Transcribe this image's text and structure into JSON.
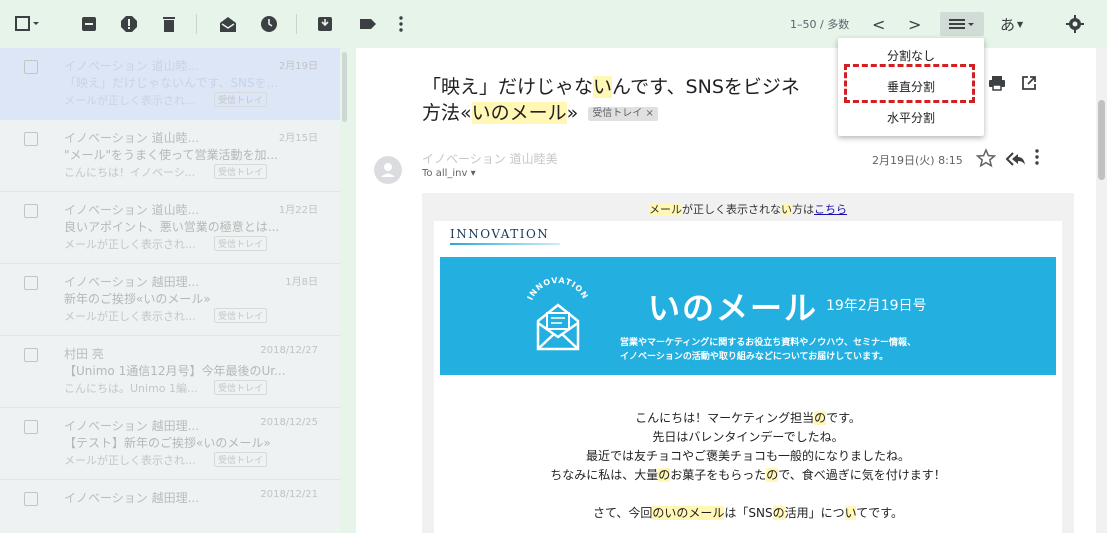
{
  "toolbar": {
    "pager": "1–50 / 多数",
    "prev": "<",
    "next": ">",
    "input_tool": "あ"
  },
  "mail_list": [
    {
      "from": "イノベーション 道山睦...",
      "date": "2月19日",
      "subject": "「映え」だけじゃないんです、SNSを...",
      "snippet": "メールが正しく表示され...",
      "label": "受信トレイ",
      "selected": true
    },
    {
      "from": "イノベーション 道山睦...",
      "date": "2月15日",
      "subject": "\"メール\"をうまく使って営業活動を加...",
      "snippet": "こんにちは！イノベーシ...",
      "label": "受信トレイ",
      "selected": false
    },
    {
      "from": "イノベーション 道山睦...",
      "date": "1月22日",
      "subject": "良いアポイント、悪い営業の極意とは...",
      "snippet": "メールが正しく表示され...",
      "label": "受信トレイ",
      "selected": false
    },
    {
      "from": "イノベーション 越田理...",
      "date": "1月8日",
      "subject": "新年のご挨拶«いのメール»",
      "snippet": "メールが正しく表示され...",
      "label": "受信トレイ",
      "selected": false
    },
    {
      "from": "村田 亮",
      "date": "2018/12/27",
      "subject": "【Unimo 1通信12月号】今年最後のUr...",
      "snippet": "こんにちは。Unimo 1編...",
      "label": "受信トレイ",
      "selected": false
    },
    {
      "from": "イノベーション 越田理...",
      "date": "2018/12/25",
      "subject": "【テスト】新年のご挨拶«いのメール»",
      "snippet": "メールが正しく表示され...",
      "label": "受信トレイ",
      "selected": false
    },
    {
      "from": "イノベーション 越田理...",
      "date": "2018/12/21",
      "subject": "",
      "snippet": "",
      "label": "",
      "selected": false
    }
  ],
  "message": {
    "subject_line1_pre": "「映え」だけじゃな",
    "subject_line1_hl": "い",
    "subject_line1_post": "んです、SNSをビジネ",
    "subject_line2_pre": "方法«",
    "subject_line2_hl": "いのメール",
    "subject_line2_post": "»",
    "inbox_chip": "受信トレイ ×",
    "sender": "イノベーション 道山睦美",
    "to": "To all_inv ▾",
    "date": "2月19日(火) 8:15"
  },
  "email_body": {
    "notice_hl1": "メール",
    "notice_mid": "が正しく表示されな",
    "notice_hl2": "い",
    "notice_post": "方は",
    "notice_link": "こちら",
    "brand": "INNOVATION",
    "banner_logo_text": "INNOVATION",
    "banner_title": "いのメール",
    "banner_date": "19年2月19日号",
    "banner_desc1": "営業やマーケティングに関するお役立ち資料やノウハウ、セミナー情報、",
    "banner_desc2": "イノベーションの活動や取り組みなどについてお届けしています。",
    "line1_pre": "こんにちは！マーケティング担当",
    "line1_hl": "の",
    "line1_post": "です。",
    "line2": "先日はバレンタインデーでしたね。",
    "line3": "最近では友チョコやご褒美チョコも一般的になりましたね。",
    "line4_a": "ちなみに私は、大量",
    "line4_hl1": "の",
    "line4_b": "お菓子をもらった",
    "line4_hl2": "の",
    "line4_c": "で、食べ過ぎに気を付けます！",
    "line5_a": "さて、今回",
    "line5_hl1": "のいのメール",
    "line5_b": "は「SNS",
    "line5_hl2": "の",
    "line5_c": "活用」につ",
    "line5_hl3": "い",
    "line5_d": "てです。"
  },
  "split_menu": {
    "items": [
      "分割なし",
      "垂直分割",
      "水平分割"
    ],
    "highlighted": "垂直分割"
  },
  "colors": {
    "banner": "#23b0e0",
    "highlight": "#fff7b3",
    "annotation_box": "#d21f1f"
  }
}
